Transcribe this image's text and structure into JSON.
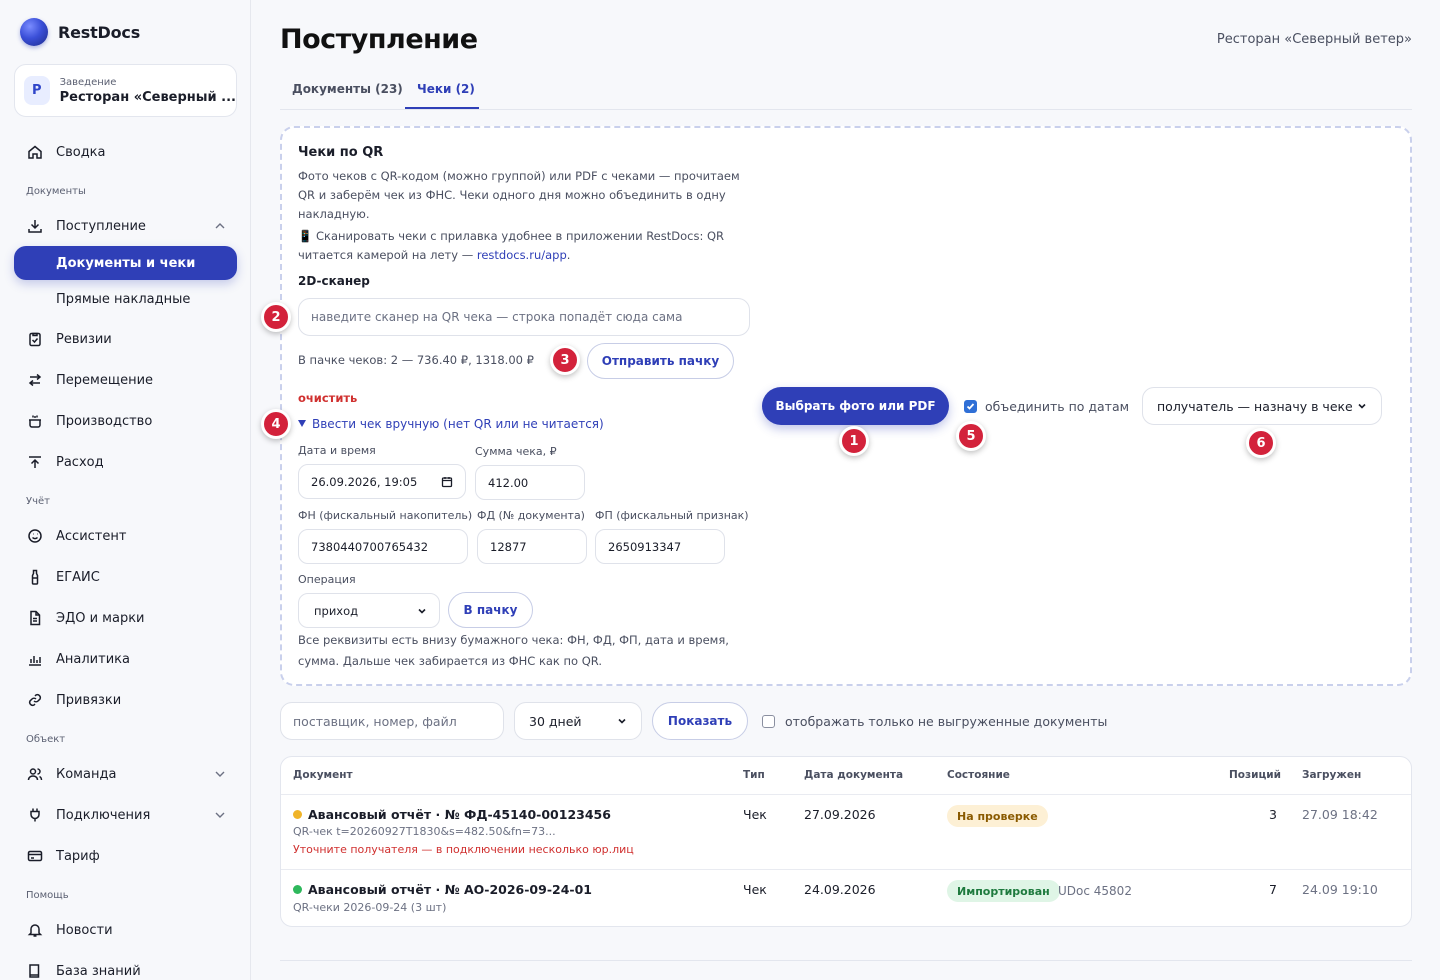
{
  "app": {
    "brand": "RestDocs"
  },
  "sidebar": {
    "venue_label": "Заведение",
    "venue_badge": "Р",
    "venue_name": "Ресторан «Северный ...",
    "summary": "Сводка",
    "section_docs": "Документы",
    "incoming": "Поступление",
    "docs_and_receipts": "Документы и чеки",
    "direct_invoices": "Прямые накладные",
    "audits": "Ревизии",
    "transfers": "Перемещение",
    "production": "Производство",
    "expense": "Расход",
    "section_accounting": "Учёт",
    "assistant": "Ассистент",
    "egais": "ЕГАИС",
    "edo": "ЭДО и марки",
    "analytics": "Аналитика",
    "bindings": "Привязки",
    "section_object": "Объект",
    "team": "Команда",
    "connections": "Подключения",
    "tariff": "Тариф",
    "section_help": "Помощь",
    "news": "Новости",
    "knowledge": "База знаний"
  },
  "header": {
    "title": "Поступление",
    "venue": "Ресторан «Северный ветер»",
    "tabs": [
      "Документы (23)",
      "Чеки (2)"
    ]
  },
  "qr": {
    "title": "Чеки по QR",
    "description": "Фото чеков с QR-кодом (можно группой) или PDF с чеками — прочитаем QR и заберём чек из ФНС. Чеки одного дня можно объединить в одну накладную.",
    "tip_text": "📱 Сканировать чеки с прилавка удобнее в приложении RestDocs: QR читается камерой на лету — ",
    "tip_link": "restdocs.ru/app",
    "tip_end": ".",
    "scanner_label": "2D-сканер",
    "scanner_placeholder": "наведите сканер на QR чека — строка попадёт сюда сама",
    "batch_info": "В пачке чеков: 2 — 736.40 ₽, 1318.00 ₽",
    "send_batch": "Отправить пачку",
    "clear": "очистить",
    "manual_toggle": "Ввести чек вручную (нет QR или не читается)",
    "upload_button": "Выбрать фото или PDF",
    "merge_label": "объединить по датам",
    "merge_checked": true,
    "recipient_select": "получатель — назначу в чеке",
    "markers": [
      "1",
      "2",
      "3",
      "4",
      "5",
      "6"
    ]
  },
  "manual": {
    "datetime_label": "Дата и время",
    "datetime_value": "26.09.2026, 19:05",
    "sum_label": "Сумма чека, ₽",
    "sum_value": "412.00",
    "fn_label": "ФН (фискальный накопитель)",
    "fn_value": "7380440700765432",
    "fd_label": "ФД (№ документа)",
    "fd_value": "12877",
    "fp_label": "ФП (фискальный признак)",
    "fp_value": "2650913347",
    "operation_label": "Операция",
    "operation_value": "приход",
    "to_batch": "В пачку",
    "hint": "Все реквизиты есть внизу бумажного чека: ФН, ФД, ФП, дата и время, сумма. Дальше чек забирается из ФНС как по QR."
  },
  "filter": {
    "search_placeholder": "поставщик, номер, файл",
    "period": "30 дней",
    "show": "Показать",
    "only_unexported": "отображать только не выгруженные документы"
  },
  "table": {
    "headers": [
      "Документ",
      "Тип",
      "Дата документа",
      "Состояние",
      "Позиций",
      "Загружен"
    ],
    "rows": [
      {
        "title": "Авансовый отчёт · № ФД-45140-00123456",
        "sub": "QR-чек t=20260927T1830&s=482.50&fn=73...",
        "warn": "Уточните получателя — в подключении несколько юр.лиц",
        "type": "Чек",
        "date": "27.09.2026",
        "status": "На проверке",
        "udoc": "",
        "positions": "3",
        "uploaded": "27.09 18:42",
        "dot_color": "#f0b429"
      },
      {
        "title": "Авансовый отчёт · № АО-2026-09-24-01",
        "sub": "QR-чеки 2026-09-24 (3 шт)",
        "warn": "",
        "type": "Чек",
        "date": "24.09.2026",
        "status": "Импортирован",
        "udoc": "UDoc 45802",
        "positions": "7",
        "uploaded": "24.09 19:10",
        "dot_color": "#2eb85c"
      }
    ]
  },
  "colors": {
    "accent": "#2f3fb7",
    "marker": "#d3223b",
    "warn": "#d0302f"
  }
}
